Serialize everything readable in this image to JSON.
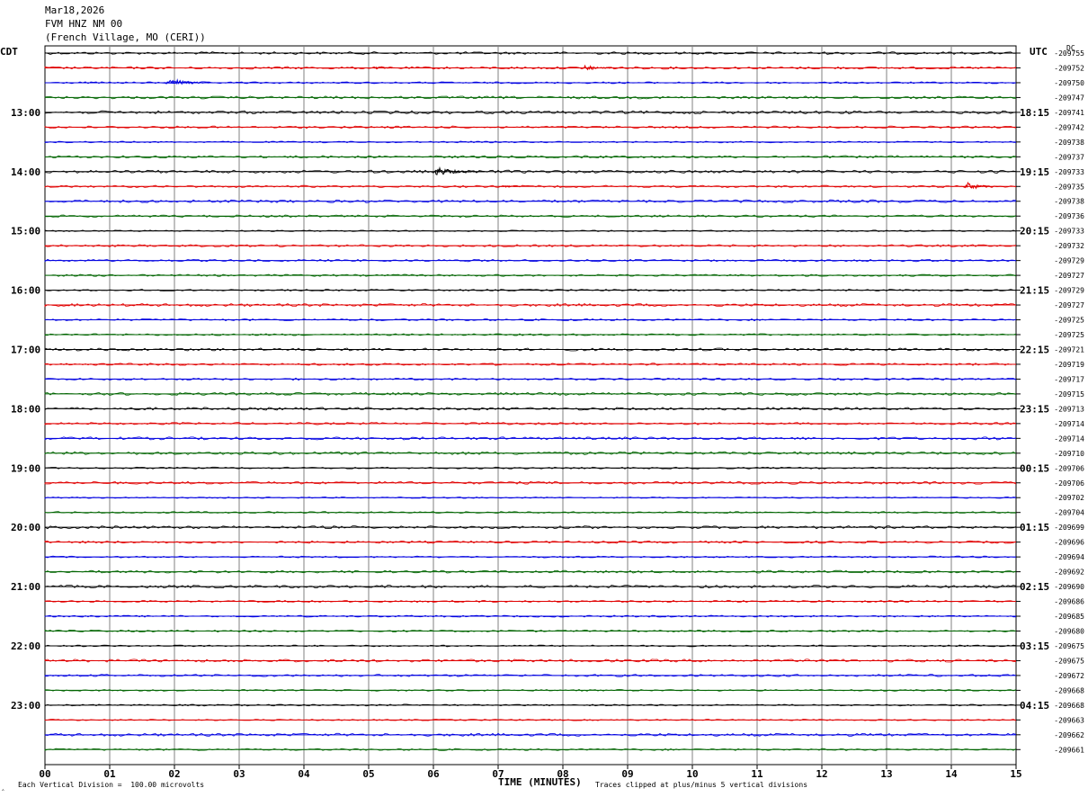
{
  "header": {
    "date": "Mar18,2026",
    "station": "FVM HNZ NM 00",
    "location": "(French Village, MO (CERI))"
  },
  "left_tz": "CDT",
  "right_tz": "UTC",
  "dc_label": "DC",
  "footer": {
    "xlabel": "TIME (MINUTES)",
    "scale_note": "Each Vertical Division =  100.00 microvolts",
    "clip_note": "Traces clipped at plus/minus 5 vertical divisions"
  },
  "colors": {
    "trace_cycle": [
      "#000000",
      "#e00000",
      "#0000e0",
      "#006400"
    ],
    "grid": "#808080"
  },
  "chart_data": {
    "type": "line",
    "title": "FVM HNZ NM 00",
    "xlabel": "TIME (MINUTES)",
    "xlim": [
      0,
      15
    ],
    "x_ticks": [
      "00",
      "01",
      "02",
      "03",
      "04",
      "05",
      "06",
      "07",
      "08",
      "09",
      "10",
      "11",
      "12",
      "13",
      "14",
      "15"
    ],
    "left_hour_labels": [
      "13:00",
      "14:00",
      "15:00",
      "16:00",
      "17:00",
      "18:00",
      "19:00",
      "20:00",
      "21:00",
      "22:00",
      "23:00"
    ],
    "right_hour_labels": [
      "18:15",
      "19:15",
      "20:15",
      "21:15",
      "22:15",
      "23:15",
      "00:15",
      "01:15",
      "02:15",
      "03:15",
      "04:15"
    ],
    "dc_offsets": [
      "-209755",
      "-209752",
      "-209750",
      "-209747",
      "-209741",
      "-209742",
      "-209738",
      "-209737",
      "-209733",
      "-209735",
      "-209738",
      "-209736",
      "-209733",
      "-209732",
      "-209729",
      "-209727",
      "-209729",
      "-209727",
      "-209725",
      "-209725",
      "-209721",
      "-209719",
      "-209717",
      "-209715",
      "-209713",
      "-209714",
      "-209714",
      "-209710",
      "-209706",
      "-209706",
      "-209702",
      "-209704",
      "-209699",
      "-209696",
      "-209694",
      "-209692",
      "-209690",
      "-209686",
      "-209685",
      "-209680",
      "-209675",
      "-209675",
      "-209672",
      "-209668",
      "-209668",
      "-209663",
      "-209662",
      "-209661"
    ],
    "events": [
      {
        "trace": 1,
        "start_min": 5.1,
        "duration_min": 0.3,
        "amplitude": 3
      },
      {
        "trace": 1,
        "start_min": 8.3,
        "duration_min": 0.6,
        "amplitude": 4
      },
      {
        "trace": 2,
        "start_min": 1.85,
        "duration_min": 0.75,
        "amplitude": 8
      },
      {
        "trace": 8,
        "start_min": 6.0,
        "duration_min": 0.8,
        "amplitude": 7
      },
      {
        "trace": 9,
        "start_min": 14.2,
        "duration_min": 0.6,
        "amplitude": 6
      },
      {
        "trace": 9,
        "start_min": 7.05,
        "duration_min": 0.3,
        "amplitude": 2
      }
    ]
  }
}
